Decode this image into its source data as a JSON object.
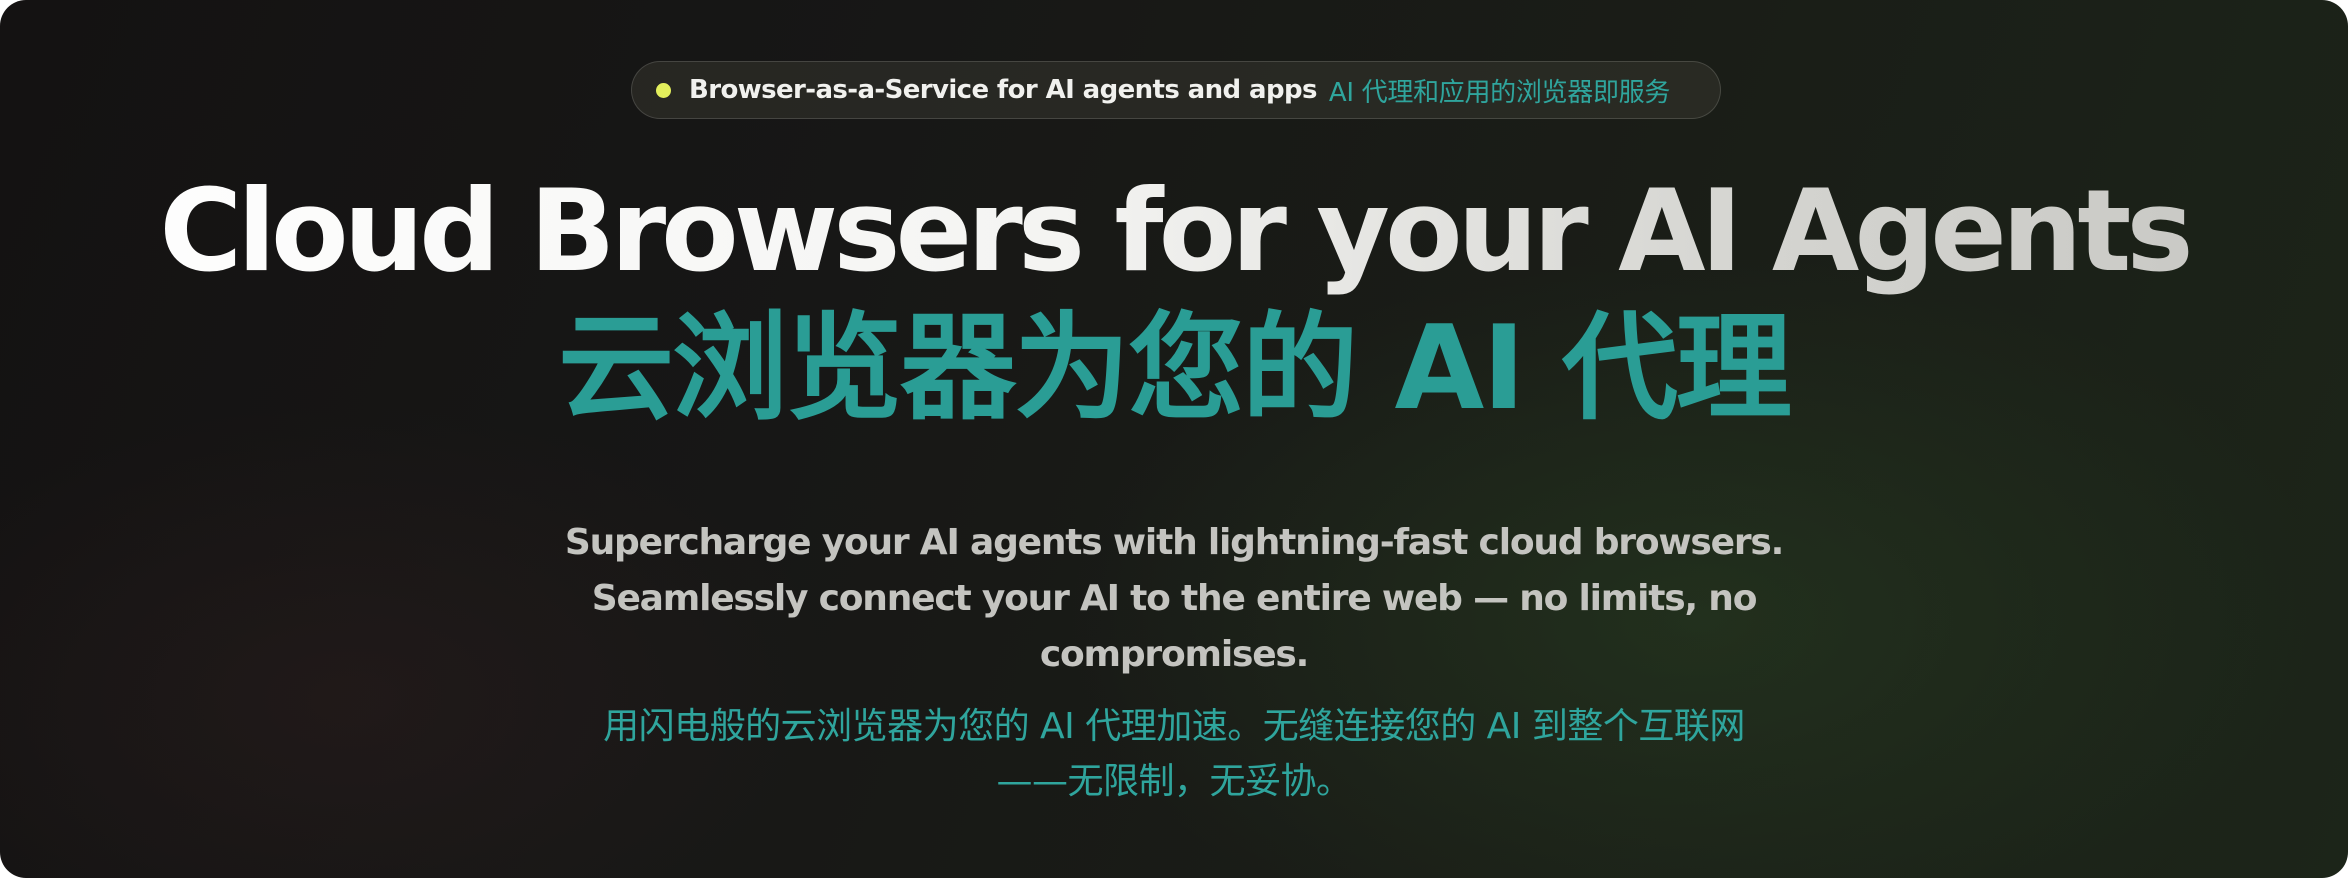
{
  "badge": {
    "dot_color": "#e3ef5c",
    "text_en": "Browser-as-a-Service for AI agents and apps",
    "text_zh": "AI 代理和应用的浏览器即服务"
  },
  "hero": {
    "title_en": "Cloud Browsers for your AI Agents",
    "title_zh": "云浏览器为您的 AI 代理",
    "accent_color": "#2a9d95"
  },
  "subtitle": {
    "en_lines": [
      "Supercharge your AI agents with lightning-fast cloud browsers.",
      "Seamlessly connect your AI to the entire web — no limits, no",
      "compromises."
    ],
    "zh_lines": [
      "用闪电般的云浏览器为您的 AI 代理加速。无缝连接您的 AI 到整个互联网",
      "——无限制，无妥协。"
    ]
  }
}
